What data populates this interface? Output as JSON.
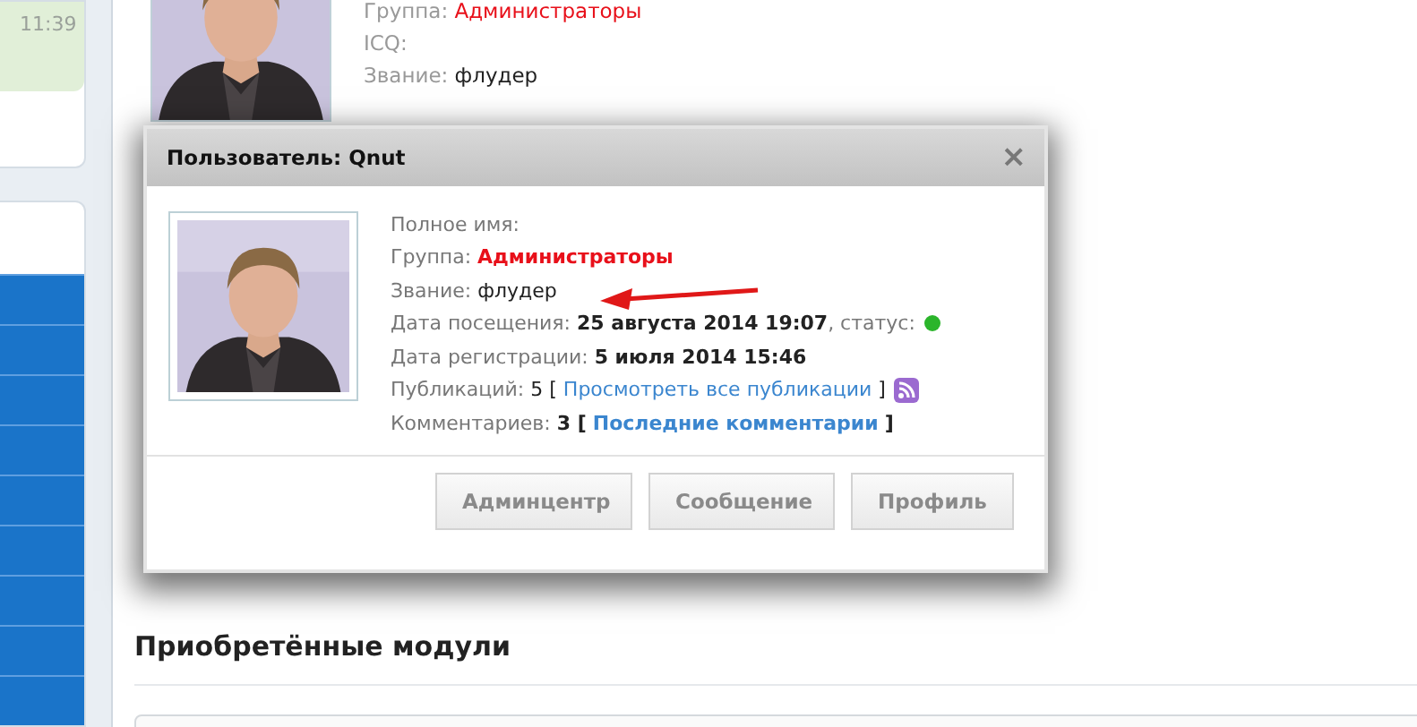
{
  "sidebar": {
    "message_time": "11:39"
  },
  "profile": {
    "group_label": "Группа:",
    "group": "Администраторы",
    "icq_label": "ICQ:",
    "rank_label": "Звание:",
    "rank": "флудер"
  },
  "dialog": {
    "title": "Пользователь: Qnut",
    "close": "×",
    "lines": [
      {
        "kind": "plain",
        "label": "Полное имя:"
      },
      {
        "kind": "group",
        "label": "Группа:",
        "value": "Администраторы"
      },
      {
        "kind": "rank",
        "label": "Звание:",
        "value": "флудер",
        "annotated": true
      },
      {
        "kind": "visit",
        "label": "Дата посещения:",
        "value": "25 августа 2014 19:07",
        "status_label": ", статус:",
        "online": true
      },
      {
        "kind": "bold",
        "label": "Дата регистрации:",
        "value": "5 июля 2014 15:46"
      },
      {
        "kind": "link",
        "label": "Публикаций:",
        "value": "5",
        "open": "[",
        "link": "Просмотреть все публикации",
        "close": "]",
        "bold": false,
        "rss": true
      },
      {
        "kind": "link",
        "label": "Комментариев:",
        "value": "3",
        "open": "[",
        "link": "Последние комментарии",
        "close": "]",
        "bold": true,
        "rss": false
      }
    ],
    "buttons": [
      "Админцентр",
      "Сообщение",
      "Профиль"
    ]
  },
  "section_title": "Приобретённые модули"
}
